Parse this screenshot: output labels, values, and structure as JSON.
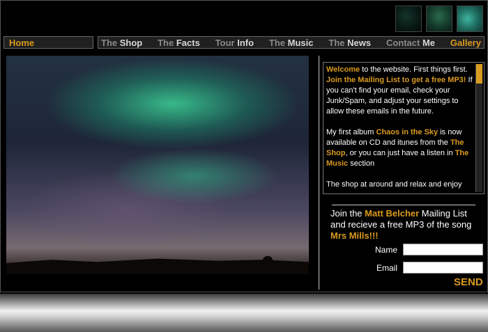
{
  "nav": {
    "home": "Home",
    "items": [
      {
        "pre": "The ",
        "main": "Shop"
      },
      {
        "pre": "The ",
        "main": "Facts"
      },
      {
        "pre": "Tour ",
        "main": "Info"
      },
      {
        "pre": "The ",
        "main": "Music"
      },
      {
        "pre": "The ",
        "main": "News"
      },
      {
        "pre": "Contact ",
        "main": "Me"
      },
      {
        "pre": "",
        "main": "Gallery"
      }
    ]
  },
  "news": {
    "p1_welcome": "Welcome",
    "p1_text1": " to the website.  First things first.  ",
    "p1_link": "Join the Mailing List to get a free MP3!",
    "p1_text2": "  If you can't find your email, check your Junk/Spam, and adjust your settings to allow these emails in the future.",
    "p2_text1": "My first album ",
    "p2_album": "Chaos in the Sky",
    "p2_text2": " is now available on CD and itunes from the ",
    "p2_shop": "The Shop",
    "p2_text3": ", or you can just have a listen in ",
    "p2_music": "The Music",
    "p2_text4": " section",
    "p3_text": "The shop at around and relax and enjoy"
  },
  "signup": {
    "join": "Join the ",
    "artist": "Matt Belcher",
    "text": " Mailing List and recieve a free MP3 of the song ",
    "song": "Mrs Mills!!!",
    "name_label": "Name",
    "email_label": "Email",
    "name_value": "",
    "email_value": "",
    "send": "SEND"
  },
  "colors": {
    "accent": "#d99a20",
    "background": "#000000"
  }
}
